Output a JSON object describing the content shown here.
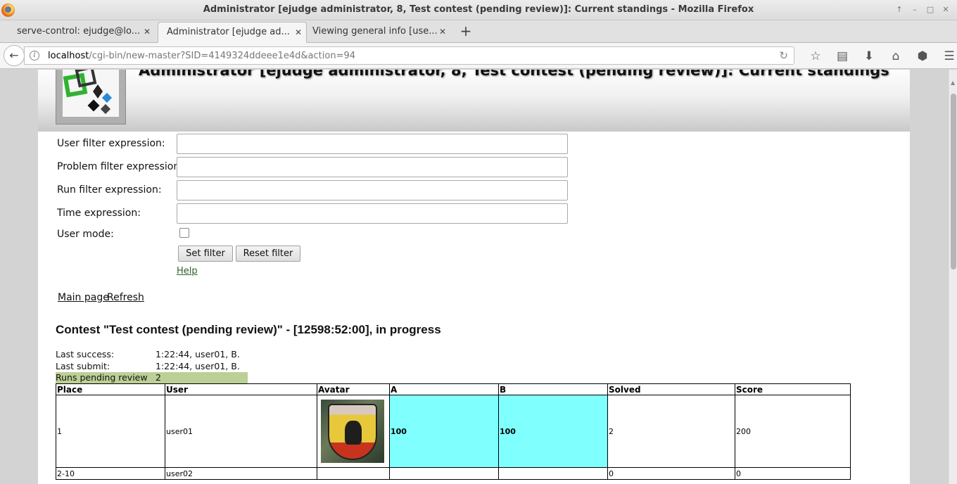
{
  "window": {
    "title": "Administrator [ejudge administrator, 8, Test contest (pending review)]: Current standings - Mozilla Firefox",
    "controls": [
      "↑",
      "–",
      "□",
      "✕"
    ]
  },
  "tabs": [
    {
      "label": "serve-control: ejudge@lo...",
      "active": false
    },
    {
      "label": "Administrator [ejudge ad...",
      "active": true
    },
    {
      "label": "Viewing general info [use...",
      "active": false
    }
  ],
  "new_tab_label": "+",
  "nav": {
    "back_icon": "←",
    "info_icon": "i",
    "url_host": "localhost",
    "url_path": "/cgi-bin/new-master?SID=4149324ddeee1e4d&action=94",
    "reload_icon": "↻",
    "toolbar_icons": [
      {
        "name": "bookmark-star-icon",
        "glyph": "☆"
      },
      {
        "name": "reader-view-icon",
        "glyph": "▤"
      },
      {
        "name": "download-icon",
        "glyph": "⬇"
      },
      {
        "name": "home-icon",
        "glyph": "⌂"
      },
      {
        "name": "pocket-icon",
        "glyph": "⬢"
      },
      {
        "name": "menu-icon",
        "glyph": "☰"
      }
    ]
  },
  "header": {
    "title": "Administrator [ejudge administrator, 8, Test contest (pending review)]: Current standings"
  },
  "filter_form": {
    "user_filter_label": "User filter expression:",
    "problem_filter_label": "Problem filter expression:",
    "run_filter_label": "Run filter expression:",
    "time_label": "Time expression:",
    "user_mode_label": "User mode:",
    "user_filter_value": "",
    "problem_filter_value": "",
    "run_filter_value": "",
    "time_value": "",
    "user_mode_checked": false,
    "set_filter_label": "Set filter",
    "reset_filter_label": "Reset filter",
    "help_label": "Help"
  },
  "links": {
    "main_page": "Main page",
    "refresh": "Refresh"
  },
  "contest": {
    "title": "Contest \"Test contest (pending review)\" - [12598:52:00], in progress",
    "last_success_label": "Last success:",
    "last_success_value": "1:22:44, user01, B.",
    "last_submit_label": "Last submit:",
    "last_submit_value": "1:22:44, user01, B.",
    "pending_label": "Runs pending review",
    "pending_value": "2"
  },
  "standings": {
    "headers": [
      "Place",
      "User",
      "Avatar",
      "A",
      "B",
      "Solved",
      "Score"
    ],
    "rows": [
      {
        "place": "1",
        "user": "user01",
        "a": "100",
        "b": "100",
        "solved": "2",
        "score": "200",
        "has_avatar": true
      },
      {
        "place": "2-10",
        "user": "user02",
        "a": "",
        "b": "",
        "solved": "0",
        "score": "0",
        "has_avatar": false
      }
    ],
    "solved_color": "#80ffff"
  }
}
